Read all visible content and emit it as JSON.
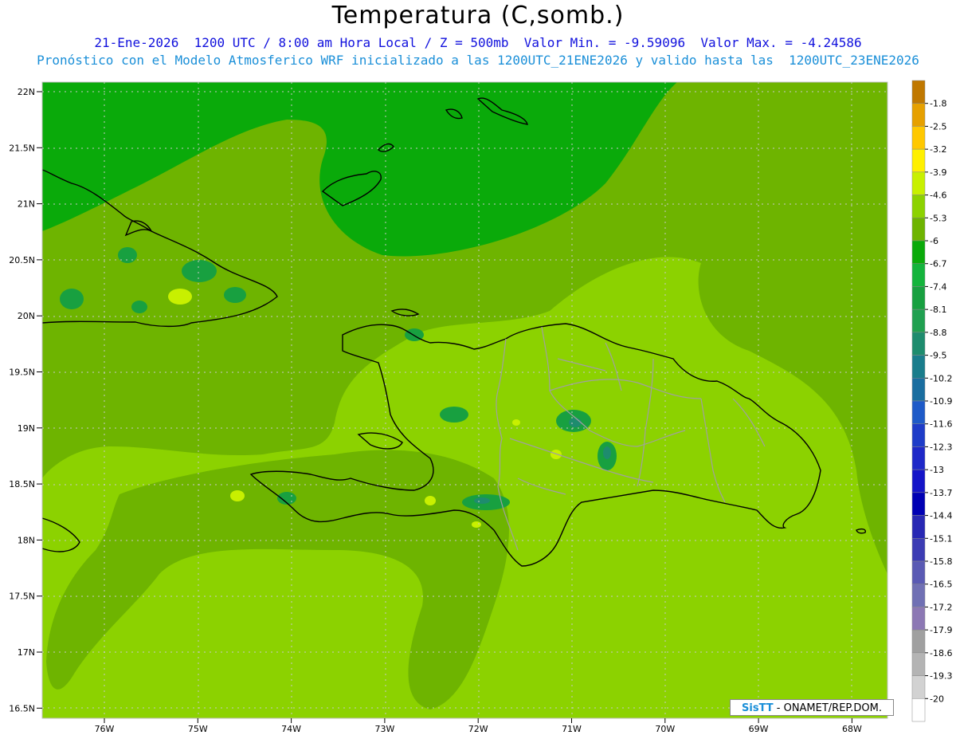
{
  "title": "Temperatura (C,somb.)",
  "subtitle_line1": "21-Ene-2026  1200 UTC / 8:00 am Hora Local / Z = 500mb  Valor Min. = -9.59096  Valor Max. = -4.24586",
  "subtitle_line2": "Pronóstico con el Modelo Atmosferico WRF inicializado a las 1200UTC_21ENE2026 y valido hasta las  1200UTC_23ENE2026",
  "credit": {
    "brand": "SisTT",
    "text": " - ONAMET/REP.DOM."
  },
  "lat_labels": [
    "22N",
    "21.5N",
    "21N",
    "20.5N",
    "20N",
    "19.5N",
    "19N",
    "18.5N",
    "18N",
    "17.5N",
    "17N",
    "16.5N"
  ],
  "lon_labels": [
    "76W",
    "75W",
    "74W",
    "73W",
    "72W",
    "71W",
    "70W",
    "69W",
    "68W"
  ],
  "legend": [
    {
      "label": "-1.8",
      "color": "#c07800"
    },
    {
      "label": "-2.5",
      "color": "#e6a000"
    },
    {
      "label": "-3.2",
      "color": "#ffc800"
    },
    {
      "label": "-3.9",
      "color": "#fff000"
    },
    {
      "label": "-4.6",
      "color": "#c8f000"
    },
    {
      "label": "-5.3",
      "color": "#8cd200"
    },
    {
      "label": "-6",
      "color": "#6eb400"
    },
    {
      "label": "-6.7",
      "color": "#0aaa0a"
    },
    {
      "label": "-7.4",
      "color": "#14b43c"
    },
    {
      "label": "-8.1",
      "color": "#18a040"
    },
    {
      "label": "-8.8",
      "color": "#20a050"
    },
    {
      "label": "-9.5",
      "color": "#1e8c6e"
    },
    {
      "label": "-10.2",
      "color": "#1a7d8c"
    },
    {
      "label": "-10.9",
      "color": "#1a6ea0"
    },
    {
      "label": "-11.6",
      "color": "#1e5ac8"
    },
    {
      "label": "-12.3",
      "color": "#1e3cc8"
    },
    {
      "label": "-13",
      "color": "#1e28c8"
    },
    {
      "label": "-13.7",
      "color": "#1414c8"
    },
    {
      "label": "-14.4",
      "color": "#0000b4"
    },
    {
      "label": "-15.1",
      "color": "#2828b4"
    },
    {
      "label": "-15.8",
      "color": "#3c3cb4"
    },
    {
      "label": "-16.5",
      "color": "#5a5ab4"
    },
    {
      "label": "-17.2",
      "color": "#7070b4"
    },
    {
      "label": "-17.9",
      "color": "#8c78b4"
    },
    {
      "label": "-18.6",
      "color": "#a0a0a0"
    },
    {
      "label": "-19.3",
      "color": "#b4b4b4"
    },
    {
      "label": "-20",
      "color": "#d2d2d2"
    },
    {
      "label": "",
      "color": "#ffffff"
    }
  ],
  "colors": {
    "field_base": "#8cd200",
    "field_mid": "#6eb400",
    "field_cold": "#0aaa0a",
    "field_spot": "#18a040",
    "field_warm": "#c8f000",
    "coast": "#000000",
    "borders": "#a0a0a0"
  }
}
